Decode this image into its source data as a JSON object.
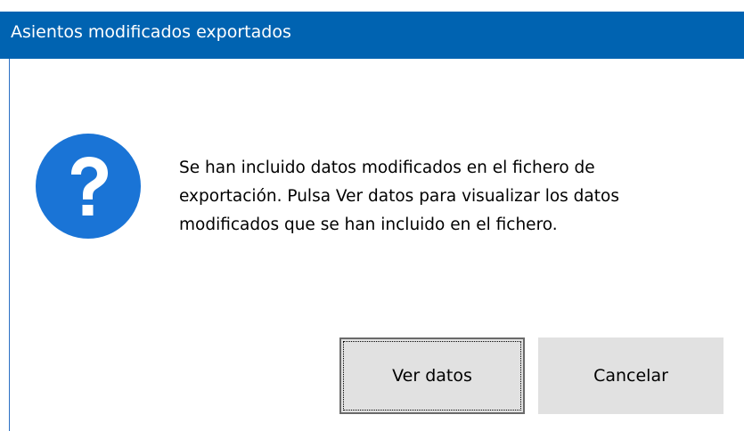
{
  "window": {
    "title": "Asientos modificados exportados"
  },
  "dialog": {
    "icon": "question-icon",
    "message": "Se han incluido datos modificados en el fichero de\nexportación. Pulsa Ver datos para visualizar los datos\nmodificados que se han incluido en el fichero."
  },
  "buttons": {
    "view_data_label": "Ver datos",
    "cancel_label": "Cancelar"
  },
  "colors": {
    "titlebar": "#0063b1",
    "icon_blue": "#1a74d6",
    "button_face": "#e1e1e1"
  }
}
